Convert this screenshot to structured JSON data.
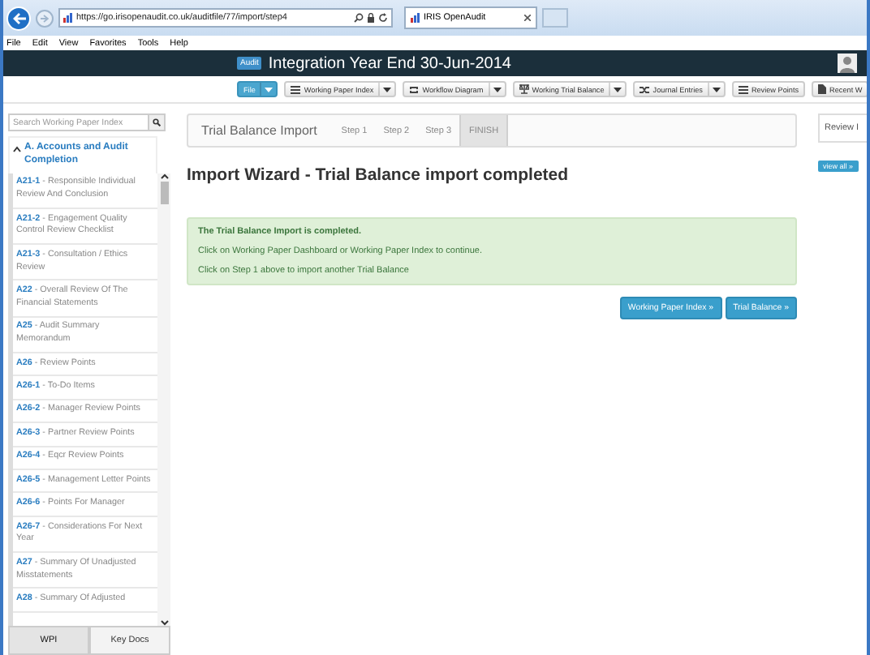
{
  "browser": {
    "address": "https://go.irisopenaudit.co.uk/auditfile/77/import/step4",
    "tab_title": "IRIS OpenAudit"
  },
  "menu": [
    "File",
    "Edit",
    "View",
    "Favorites",
    "Tools",
    "Help"
  ],
  "header": {
    "badge": "Audit",
    "title": "Integration Year End 30-Jun-2014"
  },
  "toolbar": [
    {
      "label": "File",
      "kind": "primary",
      "dropdown": true
    },
    {
      "label": "Working Paper Index",
      "kind": "default",
      "dropdown": true
    },
    {
      "label": "Workflow Diagram",
      "kind": "default",
      "dropdown": true
    },
    {
      "label": "Working Trial Balance",
      "kind": "default",
      "dropdown": true
    },
    {
      "label": "Journal Entries",
      "kind": "default",
      "dropdown": true
    },
    {
      "label": "Review Points",
      "kind": "default",
      "dropdown": false
    },
    {
      "label": "Recent W",
      "kind": "default",
      "dropdown": false
    }
  ],
  "sidebar": {
    "search": {
      "placeholder": "Search Working Paper Index"
    },
    "section": {
      "title": "A. Accounts and Audit Completion",
      "expanded": true
    },
    "items": [
      {
        "text": "**A21-1** - Responsible Individual Review And Conclusion"
      },
      {
        "text": "**A21-2** - Engagement Quality Control Review Checklist"
      },
      {
        "text": "**A21-3** - Consultation / Ethics Review"
      },
      {
        "text": "**A22** - Overall Review Of The Financial Statements"
      },
      {
        "text": "**A25** - Audit Summary Memorandum"
      },
      {
        "text": "**A26** - Review Points"
      },
      {
        "text": "**A26-1** - To-Do Items"
      },
      {
        "text": "**A26-2** - Manager Review Points"
      },
      {
        "text": "**A26-3** - Partner Review Points"
      },
      {
        "text": "**A26-4** - Eqcr Review Points"
      },
      {
        "text": "**A26-5** - Management Letter Points"
      },
      {
        "text": "**A26-6** - Points For Manager"
      },
      {
        "text": "**A26-7** - Considerations For Next Year"
      },
      {
        "text": "**A27** - Summary Of Unadjusted Misstatements"
      },
      {
        "text": "**A28** - Summary Of Adjusted"
      }
    ],
    "tabs": [
      {
        "label": "WPI",
        "selected": true
      },
      {
        "label": "Key Docs",
        "selected": false
      }
    ]
  },
  "wizard": {
    "title": "Trial Balance Import",
    "steps": [
      {
        "label": "Step 1",
        "selected": false
      },
      {
        "label": "Step 2",
        "selected": false
      },
      {
        "label": "Step 3",
        "selected": false
      },
      {
        "label": "FINISH",
        "selected": true
      }
    ]
  },
  "heading": "Import Wizard - Trial Balance import completed",
  "alert": {
    "title": "The Trial Balance Import is completed.",
    "lines": [
      "Click on Working Paper Dashboard or Working Paper Index to continue.",
      "Click on Step 1 above to import another Trial Balance"
    ]
  },
  "actions": [
    "Working Paper Index »",
    "Trial Balance »"
  ],
  "right_panel": {
    "tab": "Review I",
    "button": "view all »"
  }
}
